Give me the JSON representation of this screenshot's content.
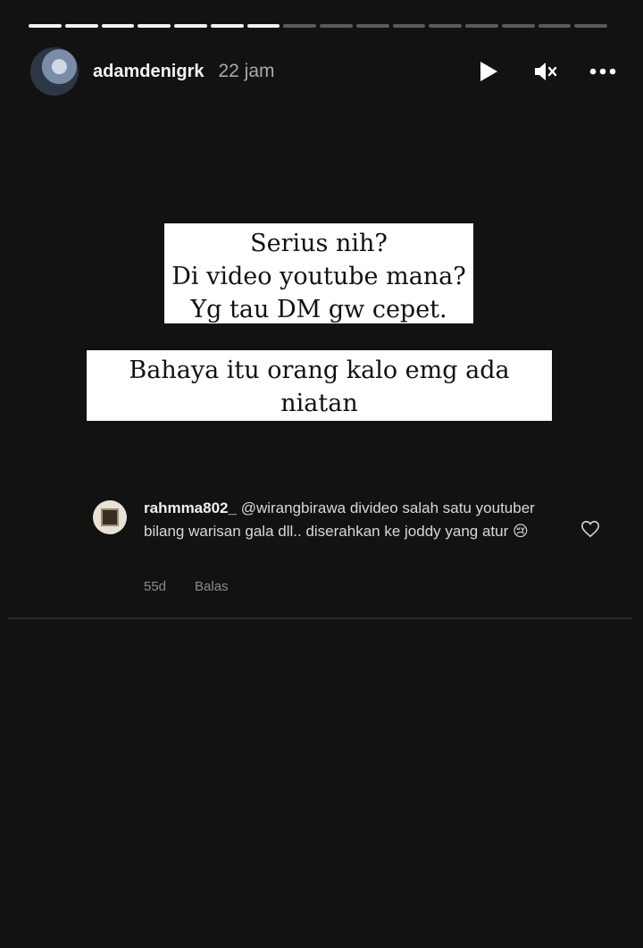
{
  "story": {
    "segments_total": 16,
    "segments_viewed": 7,
    "username": "adamdenigrk",
    "time": "22 jam",
    "text_block_1": [
      "Serius nih?",
      "Di video youtube mana?",
      "Yg tau DM gw cepet."
    ],
    "text_block_2": [
      "Bahaya itu orang kalo emg ada niatan",
      "“sengaja” karena warisan."
    ]
  },
  "controls": {
    "play_icon": "play-icon",
    "mute_icon": "volume-muted-icon",
    "more_icon": "more-horizontal-icon"
  },
  "comment": {
    "username": "rahmma802_",
    "text": "@wirangbirawa divideo salah satu youtuber bilang warisan gala dll.. diserahkan ke joddy yang atur 😢",
    "age": "55d",
    "reply_label": "Balas"
  },
  "colors": {
    "background": "#121212",
    "text_box": "#ffffff"
  }
}
